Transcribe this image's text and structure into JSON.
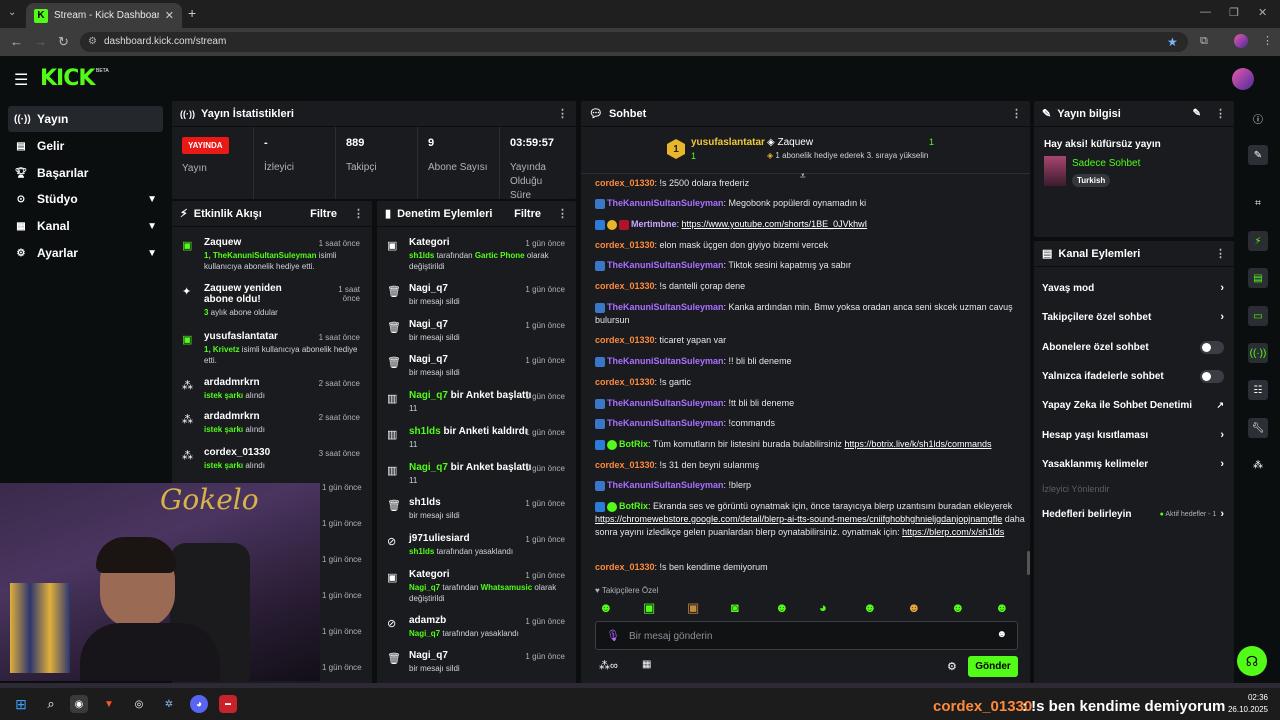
{
  "browser": {
    "tab_title": "Stream - Kick Dashboard",
    "url": "dashboard.kick.com/stream"
  },
  "header": {
    "logo": "KICK",
    "beta": "BETA"
  },
  "sidebar": {
    "items": [
      {
        "label": "Yayın",
        "icon": "broadcast-icon"
      },
      {
        "label": "Gelir",
        "icon": "revenue-icon"
      },
      {
        "label": "Başarılar",
        "icon": "trophy-icon"
      },
      {
        "label": "Stüdyo",
        "icon": "studio-icon"
      },
      {
        "label": "Kanal",
        "icon": "channel-icon"
      },
      {
        "label": "Ayarlar",
        "icon": "gear-icon"
      }
    ]
  },
  "stats": {
    "title": "Yayın İstatistikleri",
    "live_label": "YAYINDA",
    "status_label": "Yayın",
    "viewers_value": "-",
    "viewers_label": "İzleyici",
    "followers_value": "889",
    "followers_label": "Takipçi",
    "subs_value": "9",
    "subs_label": "Abone Sayısı",
    "uptime_value": "03:59:57",
    "uptime_label": "Yayında Olduğu Süre"
  },
  "activity": {
    "title": "Etkinlik Akışı",
    "filter": "Filtre",
    "items": [
      {
        "name": "Zaquew",
        "desc_green": "1, TheKanuniSultanSuleyman",
        "desc": " isimli kullanıcıya abonelik hediye etti.",
        "time": "1 saat önce"
      },
      {
        "name": "Zaquew yeniden abone oldu!",
        "desc_green": "3",
        "desc": " aylık abone oldular",
        "time": "1 saat önce"
      },
      {
        "name": "yusufaslantatar",
        "desc_green": "1, Krivetz",
        "desc": " isimli kullanıcıya abonelik hediye etti.",
        "time": "1 saat önce"
      },
      {
        "name": "ardadmrkrn",
        "desc_green": "istek şarkı",
        "desc": " alındı",
        "time": "2 saat önce"
      },
      {
        "name": "ardadmrkrn",
        "desc_green": "istek şarkı",
        "desc": " alındı",
        "time": "2 saat önce"
      },
      {
        "name": "cordex_01330",
        "desc_green": "istek şarkı",
        "desc": " alındı",
        "time": "3 saat önce"
      }
    ],
    "more_times": [
      "1 gün önce",
      "1 gün önce",
      "1 gün önce",
      "1 gün önce",
      "1 gün önce",
      "1 gün önce"
    ]
  },
  "overlay_text": "Gokelo",
  "moderation": {
    "title": "Denetim Eylemleri",
    "filter": "Filtre",
    "items": [
      {
        "name": "Kategori",
        "g1": "sh1lds",
        "t1": " tarafından ",
        "g2": "Gartic Phone",
        "t2": " olarak değiştirildi",
        "time": "1 gün önce"
      },
      {
        "name": "Nagi_q7",
        "g1": "",
        "t1": "bir mesajı sildi",
        "g2": "",
        "t2": "",
        "time": "1 gün önce"
      },
      {
        "name": "Nagi_q7",
        "g1": "",
        "t1": "bir mesajı sildi",
        "g2": "",
        "t2": "",
        "time": "1 gün önce"
      },
      {
        "name": "Nagi_q7",
        "g1": "",
        "t1": "bir mesajı sildi",
        "g2": "",
        "t2": "",
        "time": "1 gün önce"
      },
      {
        "name_green": "Nagi_q7",
        "name": " bir Anket başlattı",
        "g1": "",
        "t1": "11",
        "g2": "",
        "t2": "",
        "time": "1 gün önce"
      },
      {
        "name_green": "sh1lds",
        "name": " bir Anketi kaldırdı",
        "g1": "",
        "t1": "11",
        "g2": "",
        "t2": "",
        "time": "1 gün önce"
      },
      {
        "name_green": "Nagi_q7",
        "name": " bir Anket başlattı",
        "g1": "",
        "t1": "11",
        "g2": "",
        "t2": "",
        "time": "1 gün önce"
      },
      {
        "name": "sh1lds",
        "g1": "",
        "t1": "bir mesajı sildi",
        "g2": "",
        "t2": "",
        "time": "1 gün önce"
      },
      {
        "name": "j971uliesiard",
        "g1": "sh1lds",
        "t1": " tarafından yasaklandı",
        "g2": "",
        "t2": "",
        "time": "1 gün önce"
      },
      {
        "name": "Kategori",
        "g1": "Nagi_q7",
        "t1": " tarafından ",
        "g2": "Whatsamusic",
        "t2": " olarak değiştirildi",
        "time": "1 gün önce"
      },
      {
        "name": "adamzb",
        "g1": "Nagi_q7",
        "t1": " tarafından yasaklandı",
        "g2": "",
        "t2": "",
        "time": "1 gün önce"
      },
      {
        "name": "Nagi_q7",
        "g1": "",
        "t1": "bir mesajı sildi",
        "g2": "",
        "t2": "",
        "time": "1 gün önce"
      }
    ]
  },
  "chat": {
    "title": "Sohbet",
    "gift_left_user": "yusufaslantatar",
    "gift_left_count": "1",
    "gift_rank": "1",
    "gift_right_user": "Zaquew",
    "gift_right_count": "1",
    "gift_hint": "1 abonelik hediye ederek 3. sıraya yükselin",
    "messages": [
      {
        "user": "cordex_01330",
        "color": "or",
        "text": ": !s 2500 dolara frederiz"
      },
      {
        "user": "TheKanuniSultanSuleyman",
        "color": "pu",
        "text": ": Megobonk popülerdi oynamadın ki"
      },
      {
        "user": "Mertimbne",
        "color": "bl",
        "text": ": ",
        "link": "https://www.youtube.com/shorts/1BE_0JVkhwI"
      },
      {
        "user": "cordex_01330",
        "color": "or",
        "text": ": elon mask üçgen don giyiyo bizemi vercek"
      },
      {
        "user": "TheKanuniSultanSuleyman",
        "color": "pu",
        "text": ": Tiktok sesini kapatmış ya sabır"
      },
      {
        "user": "cordex_01330",
        "color": "or",
        "text": ": !s dantelli çorap dene"
      },
      {
        "user": "TheKanuniSultanSuleyman",
        "color": "pu",
        "text": ": Kanka ardından min. Bmw yoksa oradan anca seni skcek uzman cavuş bulursun"
      },
      {
        "user": "cordex_01330",
        "color": "or",
        "text": ": ticaret yapan var"
      },
      {
        "user": "TheKanuniSultanSuleyman",
        "color": "pu",
        "text": ": !! bli bli deneme"
      },
      {
        "user": "cordex_01330",
        "color": "or",
        "text": ": !s gartic"
      },
      {
        "user": "TheKanuniSultanSuleyman",
        "color": "pu",
        "text": ": !tt bli bli deneme"
      },
      {
        "user": "TheKanuniSultanSuleyman",
        "color": "pu",
        "text": ": !commands"
      },
      {
        "user": "BotRix",
        "color": "gr",
        "text": ": Tüm komutların bir listesini burada bulabilirsiniz ",
        "link": "https://botrix.live/k/sh1lds/commands"
      },
      {
        "user": "cordex_01330",
        "color": "or",
        "text": ": !s 31 den beyni sulanmış"
      },
      {
        "user": "TheKanuniSultanSuleyman",
        "color": "pu",
        "text": ": !blerp"
      },
      {
        "user": "BotRix",
        "color": "gr",
        "text": ": Ekranda ses ve görüntü oynatmak için, önce tarayıcıya blerp uzantısını buradan ekleyerek ",
        "link": "https://chromewebstore.google.com/detail/blerp-ai-tts-sound-memes/cniifghobhghnieljgdanjopjnamgfle",
        "text2": " daha sonra yayını izledikçe gelen puanlardan blerp oynatabilirsiniz. oynatmak için: ",
        "link2": "https://blerp.com/x/sh1lds"
      },
      {
        "user": "cordex_01330",
        "color": "or",
        "text": ": !s ben kendime demiyorum"
      }
    ],
    "follower_only": "Takipçilere Özel",
    "input_placeholder": "Bir mesaj gönderin",
    "send": "Gönder"
  },
  "stream_info": {
    "title": "Yayın bilgisi",
    "stream_title": "Hay aksi! küfürsüz yayın",
    "category": "Sadece Sohbet",
    "language": "Turkish"
  },
  "channel_actions": {
    "title": "Kanal Eylemleri",
    "items": [
      {
        "label": "Yavaş mod",
        "kind": "chevron"
      },
      {
        "label": "Takipçilere özel sohbet",
        "kind": "chevron"
      },
      {
        "label": "Abonelere özel sohbet",
        "kind": "toggle"
      },
      {
        "label": "Yalnızca ifadelerle sohbet",
        "kind": "toggle"
      },
      {
        "label": "Yapay Zeka ile Sohbet Denetimi",
        "kind": "external"
      },
      {
        "label": "Hesap yaşı kısıtlaması",
        "kind": "chevron"
      },
      {
        "label": "Yasaklanmış kelimeler",
        "kind": "chevron"
      }
    ],
    "section": "İzleyici Yönlendir",
    "goals_label": "Hedefleri belirleyin",
    "goals_status": "Aktif hedefler - 1"
  },
  "overlay_chat": {
    "user": "cordex_01330",
    "text": " : !s ben kendime demiyorum"
  },
  "taskbar": {
    "time": "02:36",
    "date": "26.10.2025"
  },
  "colors": {
    "accent": "#53fc18",
    "live": "#e91916",
    "panel": "#191b1f"
  }
}
